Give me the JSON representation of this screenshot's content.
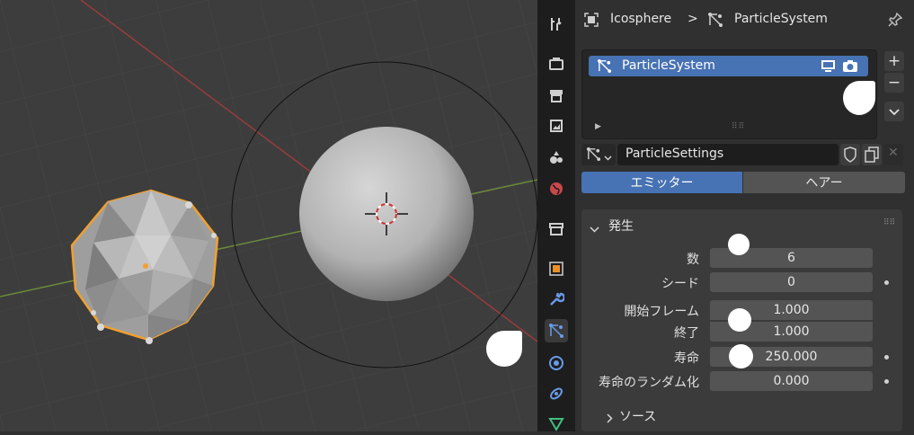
{
  "header": {
    "object_name": "Icosphere",
    "separator": ">",
    "system_name": "ParticleSystem"
  },
  "particle_list": {
    "item_label": "ParticleSystem",
    "add_label": "+",
    "remove_label": "−"
  },
  "settings": {
    "name": "ParticleSettings"
  },
  "type_tabs": {
    "emitter": "エミッター",
    "hair": "ヘアー",
    "selected": "emitter"
  },
  "emission": {
    "title": "発生",
    "fields": {
      "count": {
        "label": "数",
        "value": "6"
      },
      "seed": {
        "label": "シード",
        "value": "0"
      },
      "frame_start": {
        "label": "開始フレーム",
        "value": "1.000"
      },
      "frame_end": {
        "label": "終了",
        "value": "1.000"
      },
      "lifetime": {
        "label": "寿命",
        "value": "250.000"
      },
      "lifetime_random": {
        "label": "寿命のランダム化",
        "value": "0.000"
      }
    }
  },
  "source_panel": {
    "title": "ソース"
  },
  "colors": {
    "accent": "#4772b3",
    "selection_outline": "#e8902a",
    "panel_bg": "#303030",
    "field_bg": "#545454"
  }
}
